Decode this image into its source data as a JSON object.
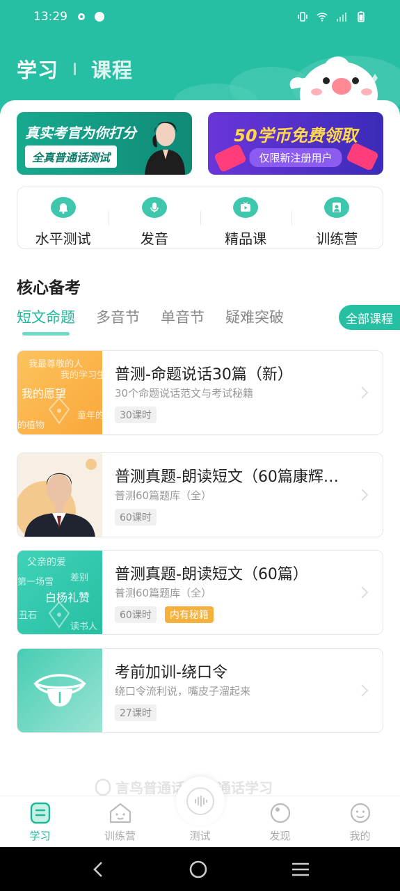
{
  "status_bar": {
    "time": "13:29"
  },
  "header": {
    "tabs": [
      {
        "label": "学习"
      },
      {
        "label": "课程"
      }
    ]
  },
  "banners": {
    "left": {
      "title": "真实考官为你打分",
      "subtitle": "全真普通话测试"
    },
    "right": {
      "title": "50学币免费领取",
      "subtitle": "仅限新注册用户"
    }
  },
  "quick_menu": [
    {
      "label": "水平测试",
      "icon": "bell-icon"
    },
    {
      "label": "发音",
      "icon": "microphone-icon"
    },
    {
      "label": "精品课",
      "icon": "tv-play-icon"
    },
    {
      "label": "训练营",
      "icon": "badge-person-icon"
    }
  ],
  "section": {
    "title": "核心备考"
  },
  "category_tabs": [
    {
      "label": "短文命题"
    },
    {
      "label": "多音节"
    },
    {
      "label": "单音节"
    },
    {
      "label": "疑难突破"
    }
  ],
  "all_courses_label": "全部课程",
  "courses": [
    {
      "title": "普测-命题说话30篇（新）",
      "subtitle": "30个命题说话范文与考试秘籍",
      "tags": [
        "30课时"
      ],
      "cover_texts": [
        "我最尊敬的人",
        "我的学习生",
        "我的愿望",
        "的植物",
        "童年的"
      ]
    },
    {
      "title": "普测真题-朗读短文（60篇康辉…",
      "subtitle": "普测60篇题库（全）",
      "tags": [
        "60课时"
      ]
    },
    {
      "title": "普测真题-朗读短文（60篇）",
      "subtitle": "普测60篇题库（全）",
      "tags": [
        "60课时",
        "内有秘籍"
      ],
      "cover_texts": [
        "父亲的爱",
        "第一场雪",
        "差别",
        "白杨礼赞",
        "丑石",
        "读书人"
      ]
    },
    {
      "title": "考前加训-绕口令",
      "subtitle": "绕口令流利说，嘴皮子溜起来",
      "tags": [
        "27课时"
      ]
    }
  ],
  "watermark": {
    "left": "言鸟普通话",
    "right": "普通话学习"
  },
  "bottom_nav": [
    {
      "label": "学习",
      "icon": "study-icon"
    },
    {
      "label": "训练营",
      "icon": "house-icon"
    },
    {
      "label": "测试",
      "icon": "voice-wave-icon"
    },
    {
      "label": "发现",
      "icon": "planet-icon"
    },
    {
      "label": "我的",
      "icon": "smile-face-icon"
    }
  ],
  "colors": {
    "brand": "#27bfa3",
    "active_text": "#1fb79a",
    "tag_orange": "#f5b13d"
  }
}
